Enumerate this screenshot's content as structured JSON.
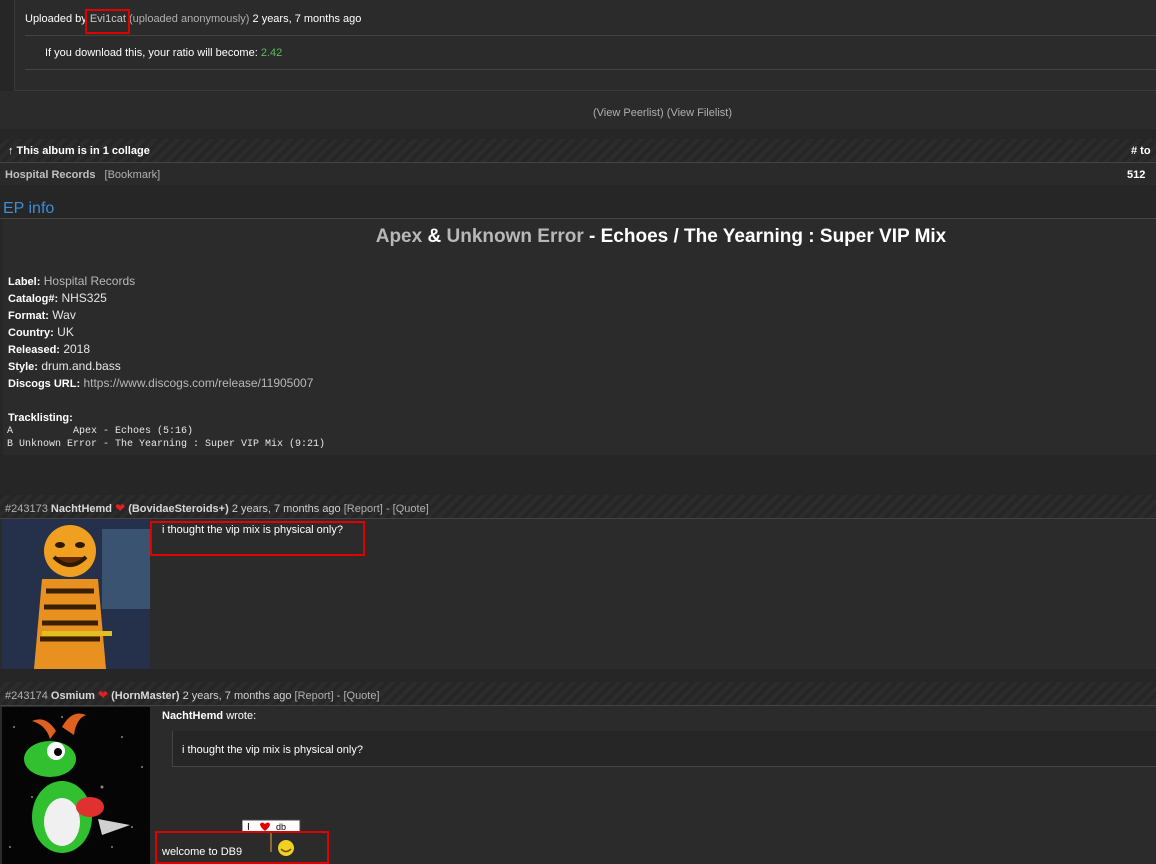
{
  "upload": {
    "prefix": "Uploaded by",
    "user": "Evi1cat",
    "anon": "(uploaded anonymously)",
    "time": "2 years, 7 months ago",
    "ratio_label": "If you download this, your ratio will become:",
    "ratio_value": "2.42"
  },
  "links": {
    "peerlist": "(View Peerlist)",
    "filelist": "(View Filelist)"
  },
  "collage": {
    "header": "↑ This album is in 1 collage",
    "col_header": "# to",
    "name": "Hospital Records",
    "bookmark": "[Bookmark]",
    "count": "512"
  },
  "ep": {
    "section_title": "EP info",
    "artist1": "Apex",
    "amp": "&",
    "artist2": "Unknown Error",
    "title": "- Echoes / The Yearning : Super VIP Mix",
    "fields": [
      {
        "key": "Label:",
        "value": "Hospital Records",
        "link": true
      },
      {
        "key": "Catalog#:",
        "value": "NHS325",
        "link": false
      },
      {
        "key": "Format:",
        "value": "Wav",
        "link": false
      },
      {
        "key": "Country:",
        "value": "UK",
        "link": false
      },
      {
        "key": "Released:",
        "value": "2018",
        "link": false
      },
      {
        "key": "Style:",
        "value": "drum.and.bass",
        "link": false
      },
      {
        "key": "Discogs URL:",
        "value": "https://www.discogs.com/release/11905007",
        "link": true
      }
    ],
    "tracklisting_label": "Tracklisting:",
    "tracks": [
      "A          Apex - Echoes (5:16)",
      "B Unknown Error - The Yearning : Super VIP Mix (9:21)"
    ]
  },
  "posts": [
    {
      "id": "#243173",
      "user": "NachtHemd",
      "heart": "❤",
      "class": "(BovidaeSteroids+)",
      "time": "2 years, 7 months ago",
      "report": "[Report]",
      "sep": "-",
      "quote": "[Quote]",
      "body": "i thought the vip mix is physical only?"
    },
    {
      "id": "#243174",
      "user": "Osmium",
      "heart": "❤",
      "class": "(HornMaster)",
      "time": "2 years, 7 months ago",
      "report": "[Report]",
      "sep": "-",
      "quote": "[Quote]",
      "quote_author": "NachtHemd",
      "quote_wrote": "wrote:",
      "quote_text": "i thought the vip mix is physical only?",
      "body": "welcome to DB9"
    }
  ],
  "colors": {
    "accent_green": "#5fb85f",
    "highlight_red": "#e00000",
    "link_blue": "#3a8fd8"
  }
}
